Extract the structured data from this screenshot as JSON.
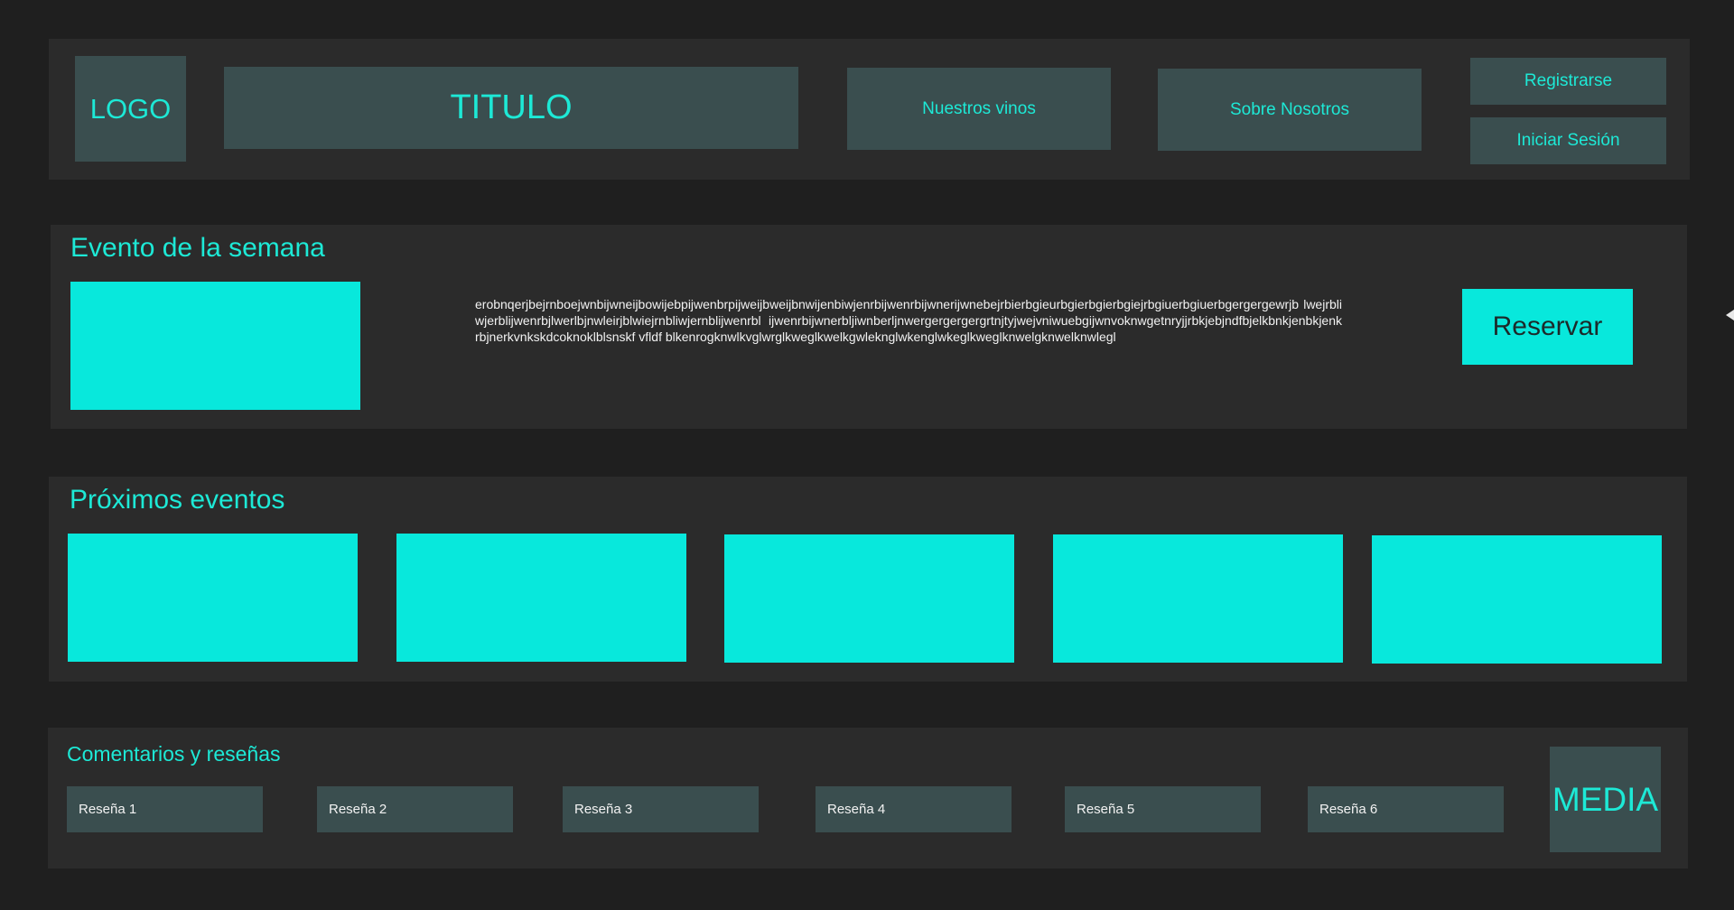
{
  "header": {
    "logo": "LOGO",
    "title": "TITULO",
    "nav": {
      "vinos": "Nuestros vinos",
      "nosotros": "Sobre Nosotros"
    },
    "auth": {
      "register": "Registrarse",
      "login": "Iniciar Sesión"
    }
  },
  "evento_semana": {
    "title": "Evento de la semana",
    "description": "erobnqerjbejrnboejwnbijwneijbowijebpijwenbrpijweijbweijbnwijenbiwjenrbijwenrbijwnerijwnebejrbierbgieurbgierbgierbgiejrbgiuerbgiuerbgergergewrjb lwejrbliwjerblijwenrbjlwerlbjnwleirjblwiejrnbliwjernblijwenrbl ijwenrbijwnerbljiwnberljnwergergergergrtnjtyjwejvniwuebgijwnvoknwgetnryjjrbkjebjndfbjelkbnkjenbkjenkrbjnerkvnkskdcoknoklblsnskf vfldf blkenrogknwlkvglwrglkweglkwelkgwleknglwkenglwkeglkweglknwelgknwelknwlegl",
    "reserve_button": "Reservar"
  },
  "proximos_eventos": {
    "title": "Próximos eventos",
    "items": [
      "",
      "",
      "",
      "",
      ""
    ]
  },
  "resenas": {
    "title": "Comentarios y reseñas",
    "items": [
      "Reseña 1",
      "Reseña 2",
      "Reseña 3",
      "Reseña 4",
      "Reseña 5",
      "Reseña 6"
    ],
    "media": "MEDIA"
  },
  "colors": {
    "background": "#1f1f1f",
    "panel": "#2b2b2b",
    "tile": "#3a4e4f",
    "accent": "#08e8dc"
  }
}
